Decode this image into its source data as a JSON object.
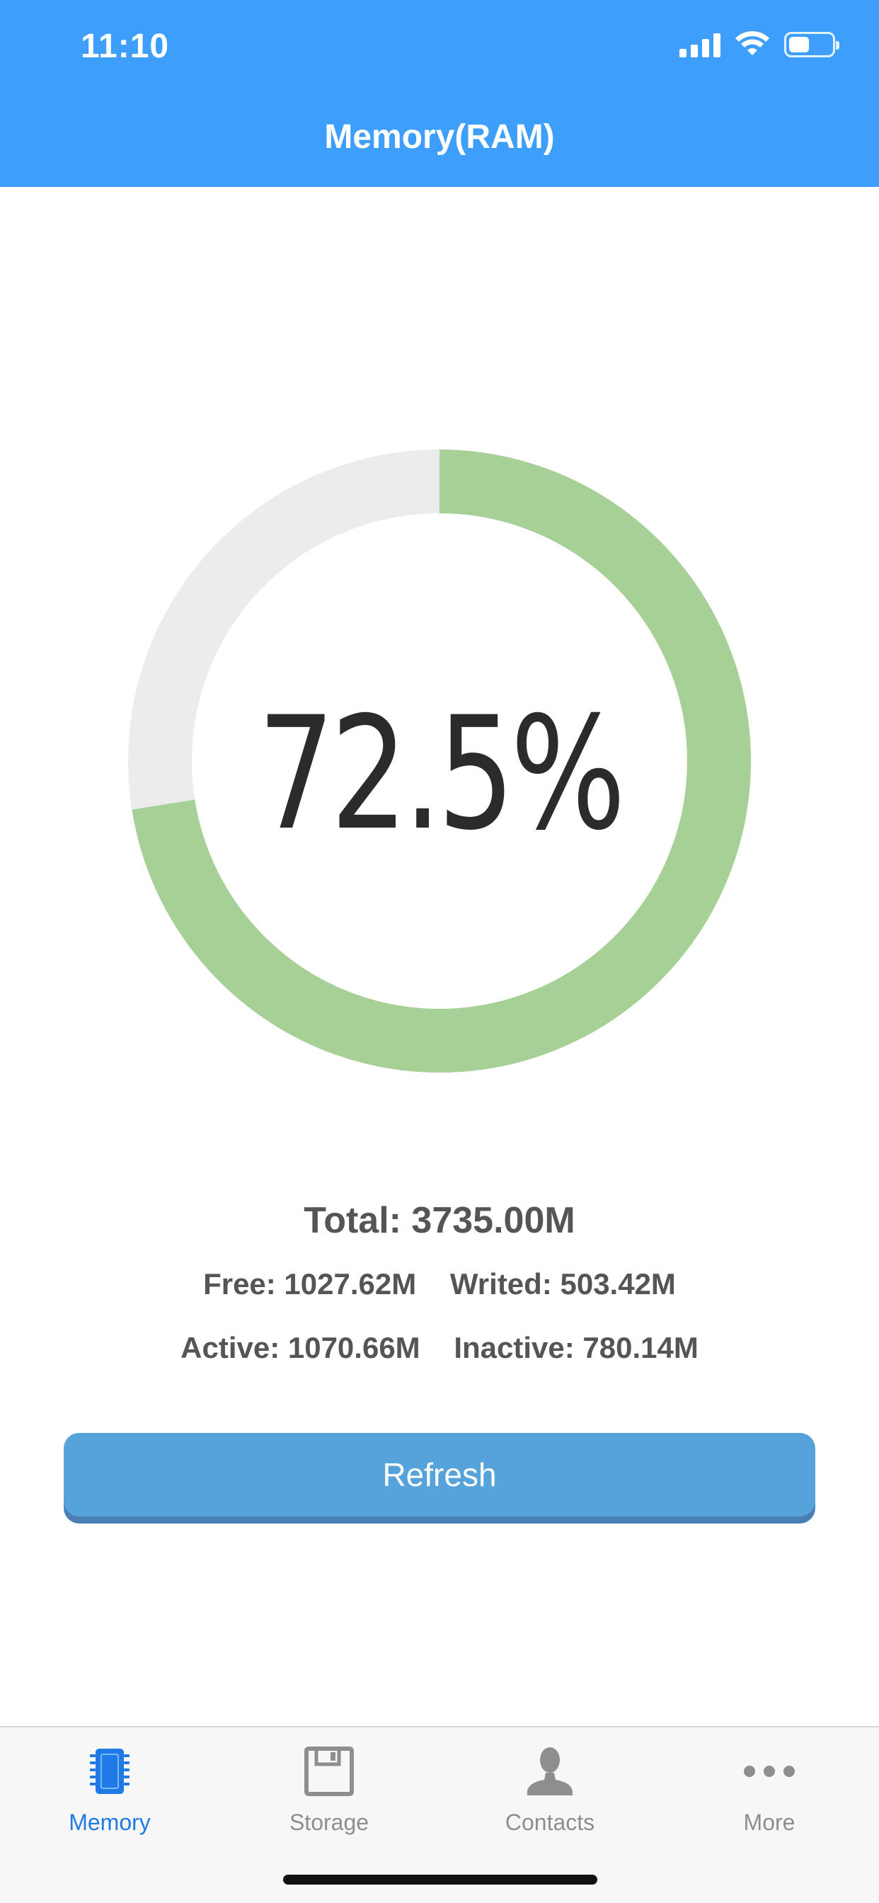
{
  "status_bar": {
    "time": "11:10"
  },
  "header": {
    "title": "Memory(RAM)"
  },
  "gauge": {
    "percent_label": "72.5%",
    "used_fraction": 0.725,
    "used_color": "#a6d096",
    "free_color": "#ececec"
  },
  "stats": {
    "total": "Total: 3735.00M",
    "free": "Free: 1027.62M",
    "writed": "Writed: 503.42M",
    "active": "Active: 1070.66M",
    "inactive": "Inactive: 780.14M"
  },
  "actions": {
    "refresh_label": "Refresh"
  },
  "tabbar": {
    "active_color": "#1f7ae6",
    "items": [
      {
        "label": "Memory",
        "icon": "chip-icon"
      },
      {
        "label": "Storage",
        "icon": "floppy-disk-icon"
      },
      {
        "label": "Contacts",
        "icon": "person-icon"
      },
      {
        "label": "More",
        "icon": "ellipsis-icon"
      }
    ]
  }
}
